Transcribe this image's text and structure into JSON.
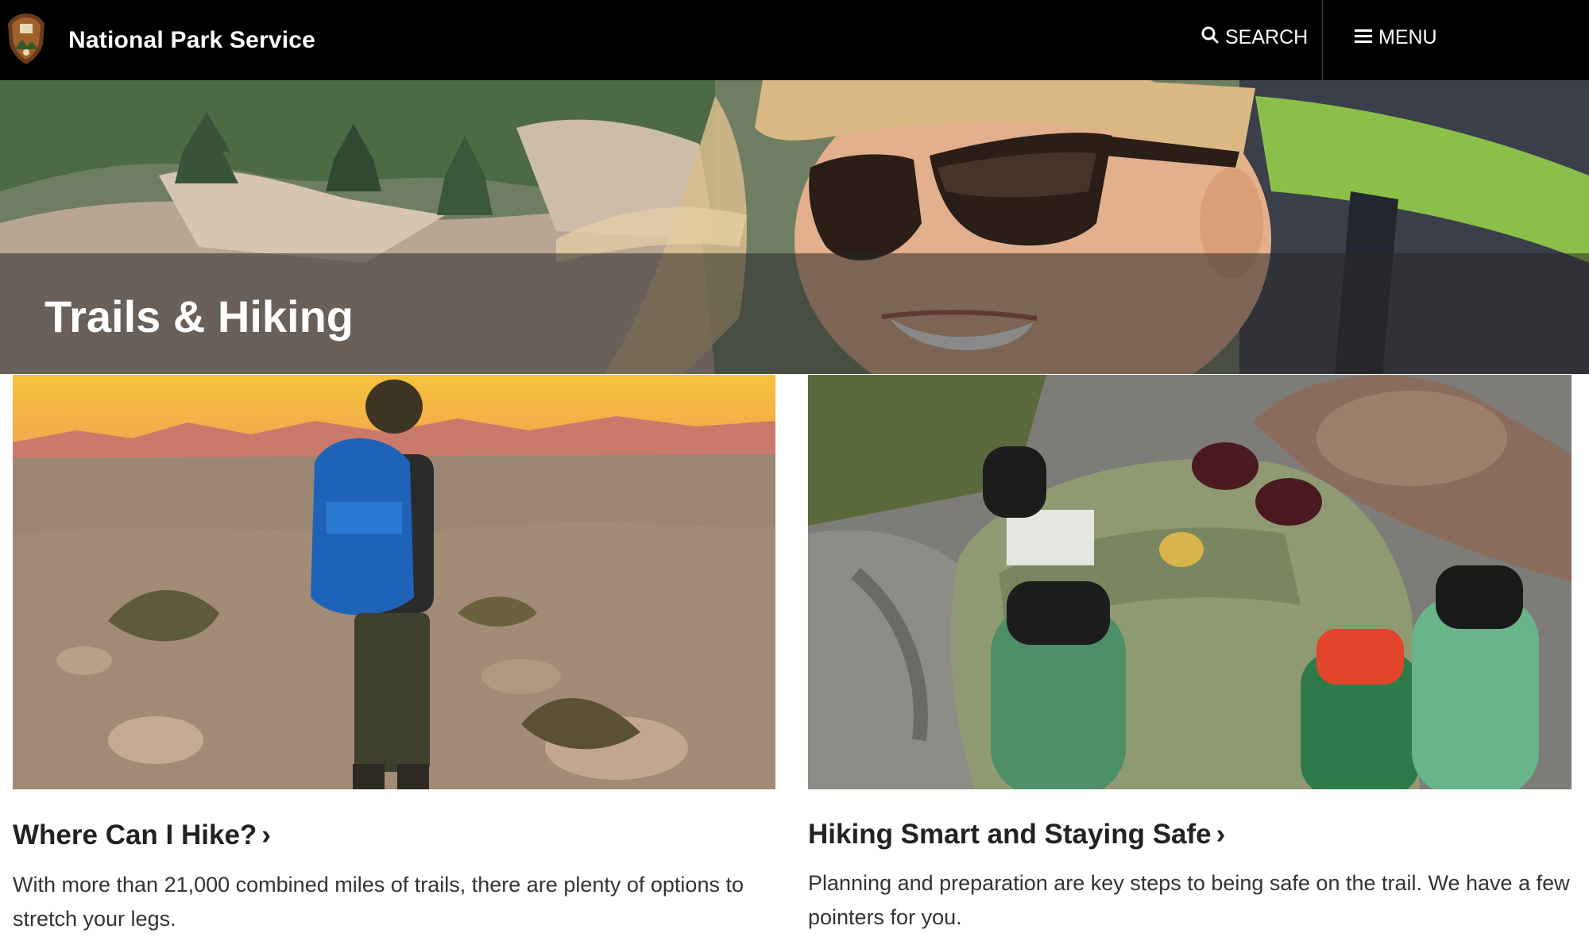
{
  "header": {
    "site_title": "National Park Service",
    "search_label": "SEARCH",
    "menu_label": "MENU",
    "icons": [
      "arrowhead-logo-icon",
      "search-icon",
      "hamburger-menu-icon"
    ]
  },
  "hero": {
    "title": "Trails & Hiking"
  },
  "cards": [
    {
      "title": "Where Can I Hike?",
      "chevron": "›",
      "description": "With more than 21,000 combined miles of trails, there are plenty of options to stretch your legs."
    },
    {
      "title": "Hiking Smart and Staying Safe",
      "chevron": "›",
      "description": "Planning and preparation are key steps to being safe on the trail. We have a few pointers for you."
    }
  ],
  "colors": {
    "header_bg": "#000000",
    "header_text": "#ffffff",
    "body_text": "#333333",
    "title_text": "#222222"
  }
}
